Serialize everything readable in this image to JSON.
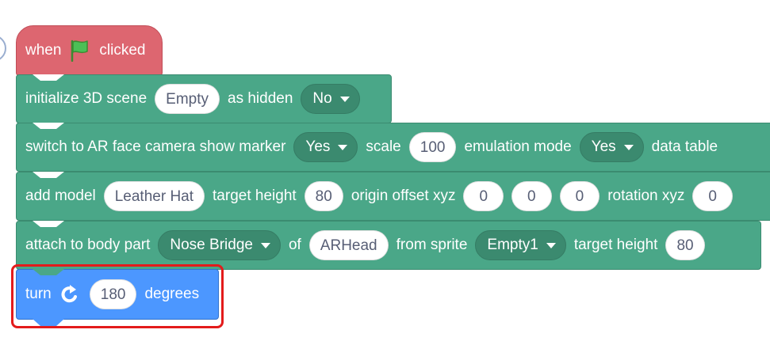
{
  "colors": {
    "events": "#dd6670",
    "extension": "#4aa788",
    "motion": "#4c97ff",
    "highlight": "#e31b1b"
  },
  "icons": {
    "flag": "green-flag-icon",
    "turn": "turn-right-icon",
    "dropdown": "caret-down-icon"
  },
  "hat": {
    "when": "when",
    "clicked": "clicked"
  },
  "init_scene": {
    "label": "initialize 3D scene",
    "scene_value": "Empty",
    "hidden_label": "as hidden",
    "hidden_value": "No"
  },
  "switch_camera": {
    "label": "switch to AR face camera show marker",
    "marker_value": "Yes",
    "scale_label": "scale",
    "scale_value": "100",
    "emulation_label": "emulation mode",
    "emulation_value": "Yes",
    "data_table_label": "data table"
  },
  "add_model": {
    "label": "add model",
    "model_value": "Leather Hat",
    "height_label": "target height",
    "height_value": "80",
    "offset_label": "origin offset xyz",
    "offset_x": "0",
    "offset_y": "0",
    "offset_z": "0",
    "rotation_label": "rotation xyz",
    "rotation_x": "0"
  },
  "attach": {
    "label": "attach to body part",
    "part_value": "Nose Bridge",
    "of_label": "of",
    "object_value": "ARHead",
    "sprite_label": "from sprite",
    "sprite_value": "Empty1",
    "height_label": "target height",
    "height_value": "80"
  },
  "turn": {
    "label": "turn",
    "value": "180",
    "unit": "degrees"
  }
}
